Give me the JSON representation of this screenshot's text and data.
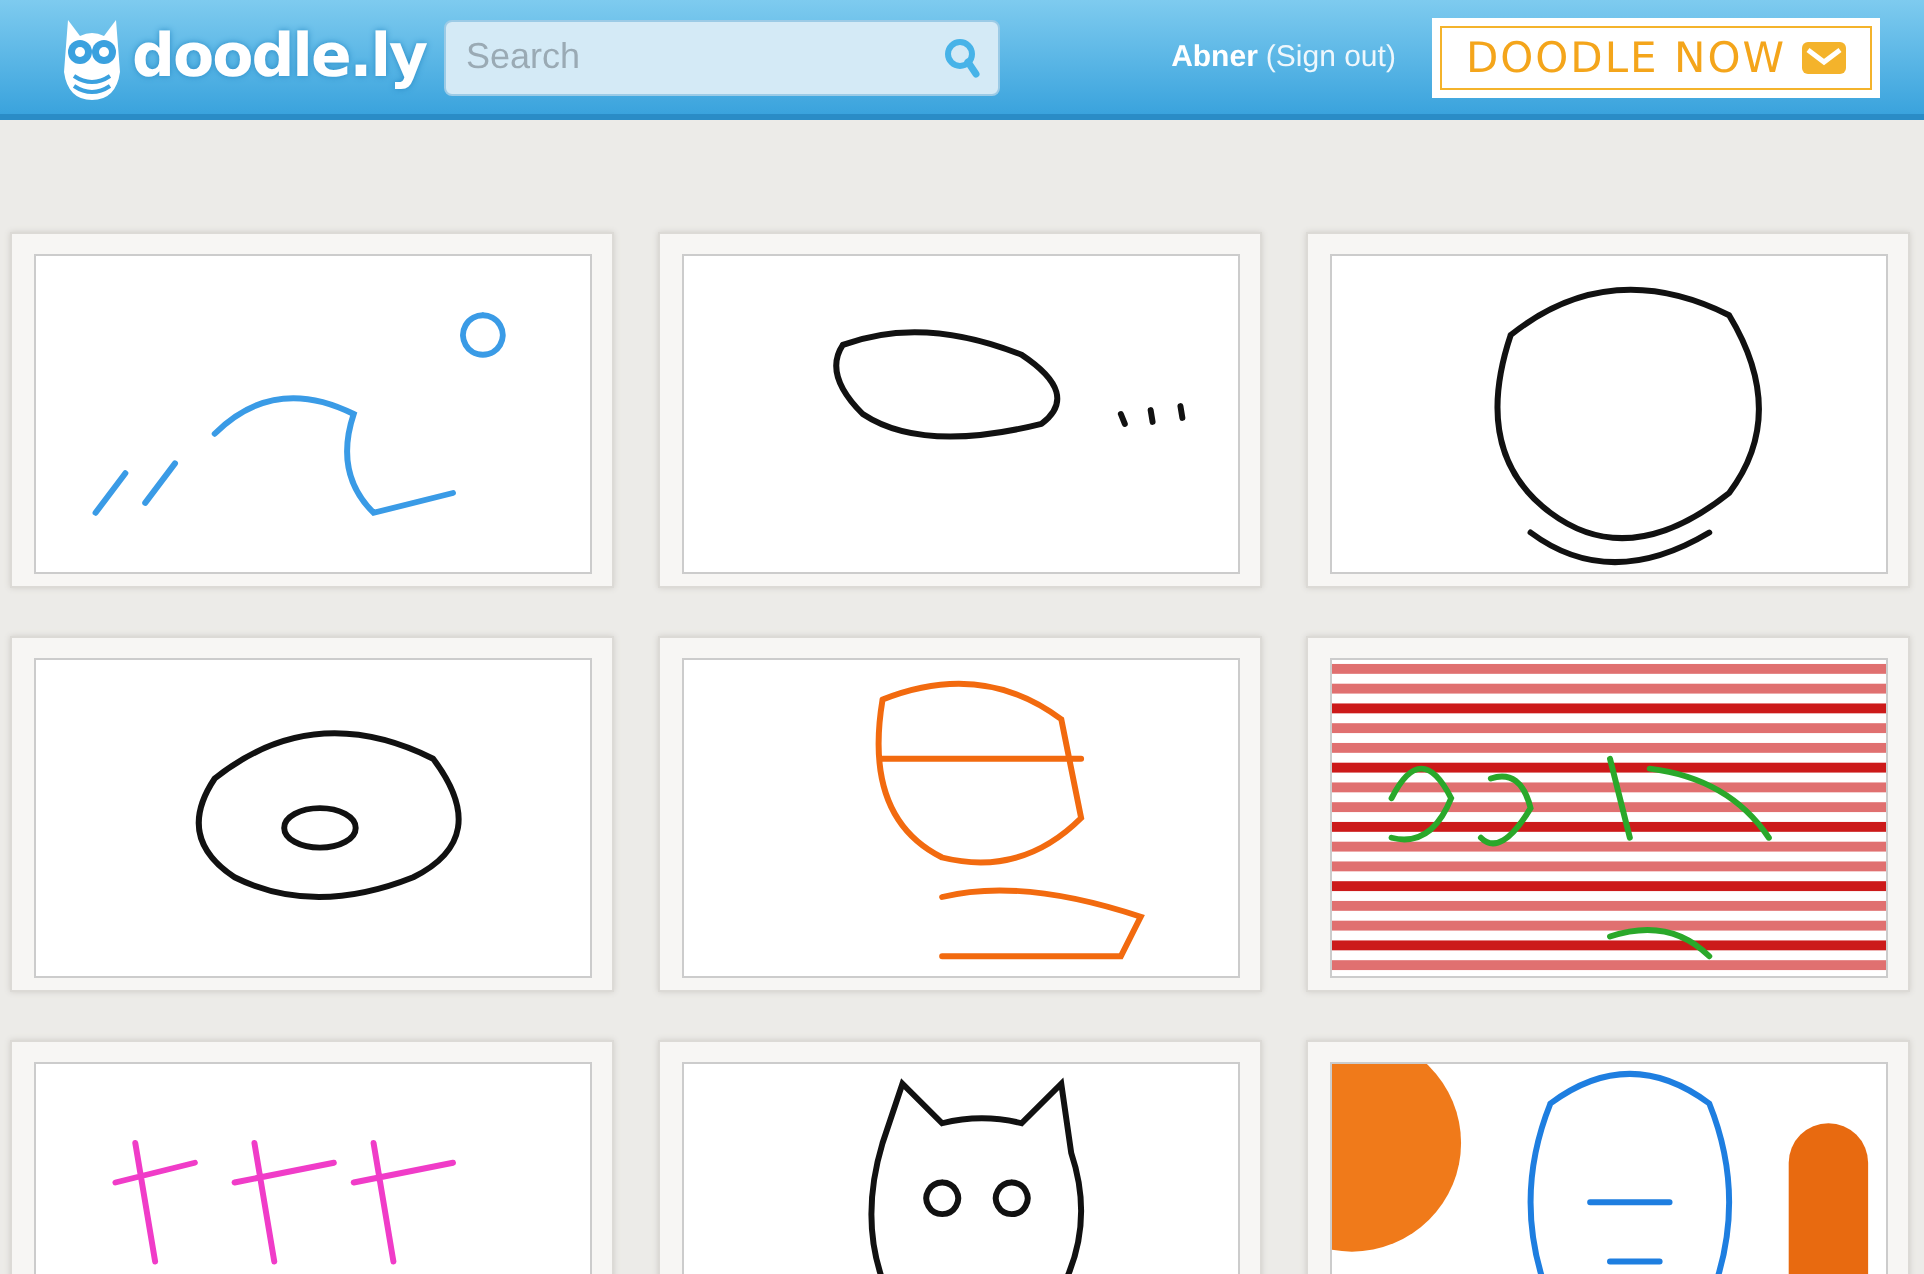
{
  "header": {
    "logo": "doodle.ly",
    "search": {
      "placeholder": "Search"
    },
    "user": "Abner",
    "sign_out": "(Sign out)",
    "cta": "DOODLE NOW"
  },
  "doodles": [
    {
      "kind": "sketch",
      "color": "#3a9be6"
    },
    {
      "kind": "sketch",
      "color": "#111111"
    },
    {
      "kind": "sketch",
      "color": "#111111"
    },
    {
      "kind": "sketch",
      "color": "#111111"
    },
    {
      "kind": "sketch",
      "color": "#f26a0f"
    },
    {
      "kind": "striped",
      "color": "#2aa82a"
    },
    {
      "kind": "sketch",
      "color": "#f03cc8"
    },
    {
      "kind": "sketch",
      "color": "#111111"
    },
    {
      "kind": "poster",
      "color": "#1e7ee0"
    }
  ]
}
